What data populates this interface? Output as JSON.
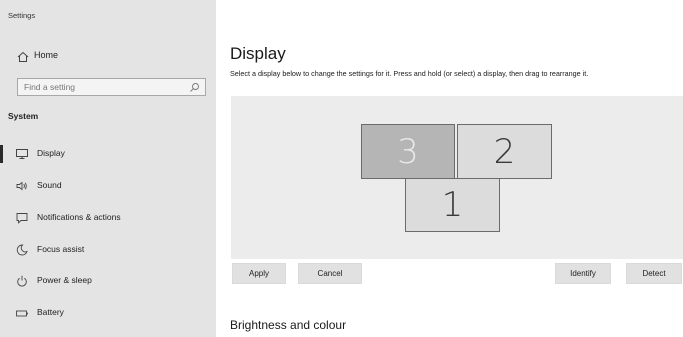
{
  "window": {
    "title": "Settings"
  },
  "sidebar": {
    "home_label": "Home",
    "search_placeholder": "Find a setting",
    "section": "System",
    "items": [
      {
        "label": "Display",
        "icon": "monitor-icon",
        "selected": true
      },
      {
        "label": "Sound",
        "icon": "speaker-icon"
      },
      {
        "label": "Notifications & actions",
        "icon": "message-icon"
      },
      {
        "label": "Focus assist",
        "icon": "moon-icon"
      },
      {
        "label": "Power & sleep",
        "icon": "power-icon"
      },
      {
        "label": "Battery",
        "icon": "battery-icon"
      }
    ]
  },
  "main": {
    "title": "Display",
    "description": "Select a display below to change the settings for it. Press and hold (or select) a display, then drag to rearrange it.",
    "monitors": [
      {
        "label": "3",
        "selected": true
      },
      {
        "label": "2"
      },
      {
        "label": "1"
      }
    ],
    "buttons": {
      "apply": "Apply",
      "cancel": "Cancel",
      "identify": "Identify",
      "detect": "Detect"
    },
    "next_section": "Brightness and colour"
  },
  "colors": {
    "sidebar_bg": "#e4e4e4",
    "display_area_bg": "#ececec",
    "selected_monitor": "#b5b5b5",
    "monitor": "#dcdcdc"
  }
}
